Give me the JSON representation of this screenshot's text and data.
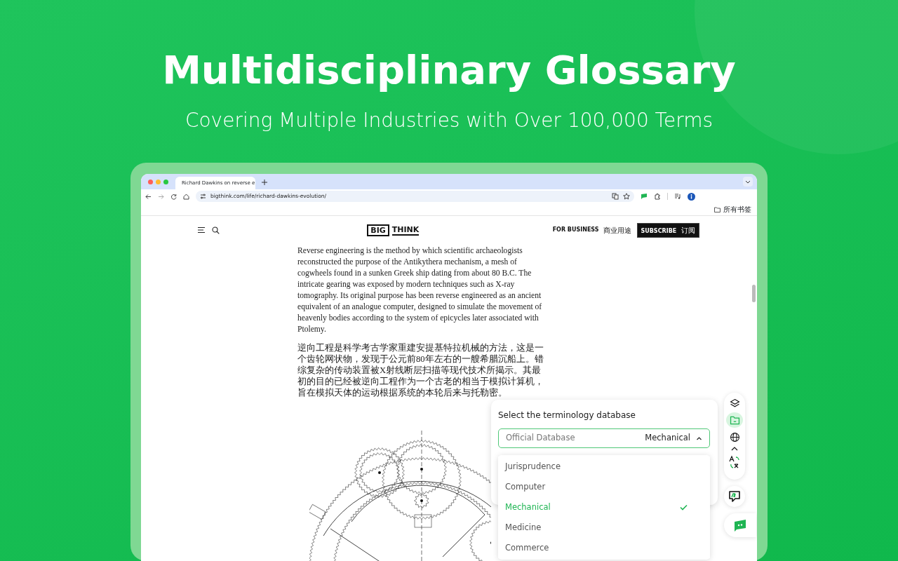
{
  "hero": {
    "title": "Multidisciplinary Glossary",
    "subtitle": "Covering Multiple Industries with Over 100,000 Terms"
  },
  "browser": {
    "tabs": [
      {
        "label": "Richard Dawkins on reverse e",
        "selected": true
      }
    ],
    "url": "bigthink.com/life/richard-dawkins-evolution/",
    "bookmarks_folder": "所有书签"
  },
  "site": {
    "logo": [
      "BIG",
      "THINK"
    ],
    "for_business": "FOR BUSINESS",
    "for_business_cn": "商业用途",
    "subscribe": "SUBSCRIBE",
    "subscribe_cn": "订阅"
  },
  "article": {
    "paragraphs": [
      "Reverse engineering is the method by which scientific archaeologists reconstructed the purpose of the Antikythera mechanism, a mesh of cogwheels found in a sunken Greek ship dating from about 80 B.C. The intricate gearing was exposed by modern techniques such as X-ray tomography. Its original purpose has been reverse engineered as an ancient equivalent of an analogue computer, designed to simulate the movement of heavenly bodies according to the system of epicycles later associated with Ptolemy.",
      "逆向工程是科学考古学家重建安提基特拉机械的方法，这是一个齿轮网状物，发现于公元前80年左右的一艘希腊沉船上。错综复杂的传动装置被X射线断层扫描等现代技术所揭示。其最初的目的已经被逆向工程作为一个古老的相当于模拟计算机，旨在模拟天体的运动根据系统的本轮后来与托勒密。"
    ]
  },
  "terminology_panel": {
    "title": "Select the terminology database",
    "select": {
      "label": "Official Database",
      "value": "Mechanical",
      "expanded": true
    },
    "options": [
      {
        "label": "Jurisprudence",
        "selected": false
      },
      {
        "label": "Computer",
        "selected": false
      },
      {
        "label": "Mechanical",
        "selected": true
      },
      {
        "label": "Medicine",
        "selected": false
      },
      {
        "label": "Commerce",
        "selected": false
      }
    ]
  },
  "toolbar": {
    "items": [
      {
        "selected": false
      },
      {
        "selected": true
      },
      {
        "selected": false
      }
    ]
  }
}
